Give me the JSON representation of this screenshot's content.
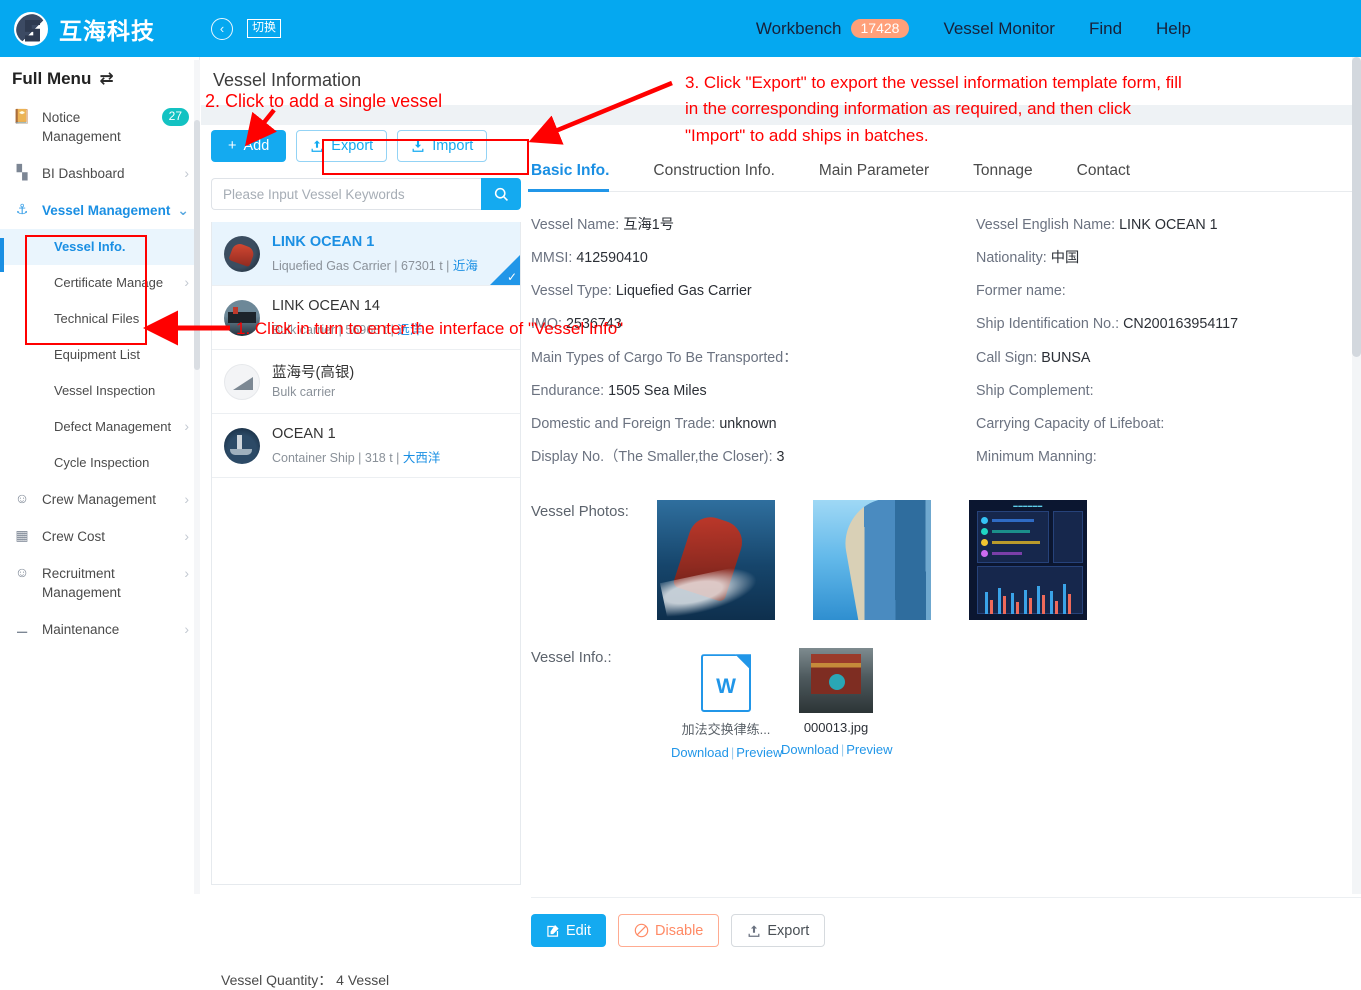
{
  "header": {
    "logo_text": "互海科技",
    "logo_icon": "company-logo-icon",
    "back_icon": "arrow-left-circle-icon",
    "switch_label": "切换",
    "workbench_label": "Workbench",
    "workbench_badge": "17428",
    "nav": [
      {
        "label": "Vessel Monitor"
      },
      {
        "label": "Find"
      },
      {
        "label": "Help"
      }
    ],
    "accent_color": "#05a8f0",
    "badge_color": "#ffa07a"
  },
  "sidebar": {
    "full_menu_label": "Full Menu",
    "swap_icon": "swap-horizontal-icon",
    "items": [
      {
        "label": "Notice Management",
        "icon": "book-icon",
        "count": "27"
      },
      {
        "label": "BI Dashboard",
        "icon": "bar-chart-icon",
        "chevron": "›"
      },
      {
        "label": "Vessel Management",
        "icon": "anchor-icon",
        "chevron": "⌄",
        "active_group": true
      }
    ],
    "vessel_children": [
      {
        "label": "Vessel Info.",
        "active": true
      },
      {
        "label": "Certificate Manage",
        "chevron": "›"
      },
      {
        "label": "Technical Files"
      },
      {
        "label": "Equipment List"
      },
      {
        "label": "Vessel Inspection"
      },
      {
        "label": "Defect Management",
        "chevron": "›"
      },
      {
        "label": "Cycle Inspection"
      }
    ],
    "items_after": [
      {
        "label": "Crew Management",
        "icon": "user-icon",
        "chevron": "›"
      },
      {
        "label": "Crew Cost",
        "icon": "wallet-icon",
        "chevron": "›"
      },
      {
        "label": "Recruitment Management",
        "icon": "user-plus-icon",
        "chevron": "›"
      },
      {
        "label": "Maintenance",
        "icon": "hammer-icon",
        "chevron": "›"
      }
    ]
  },
  "main": {
    "page_title": "Vessel Information",
    "list": {
      "add_label": "Add",
      "add_icon": "plus-icon",
      "export_label": "Export",
      "export_icon": "upload-icon",
      "import_label": "Import",
      "import_icon": "download-icon",
      "search_placeholder": "Please Input Vessel Keywords",
      "search_value": "",
      "search_icon": "search-icon",
      "quantity_label": "Vessel Quantity：",
      "quantity_value": "4 Vessel",
      "vessels": [
        {
          "name": "LINK OCEAN 1",
          "type": "Liquefied Gas Carrier",
          "tonnage": "67301 t",
          "zone": "近海",
          "meta": "Liquefied Gas Carrier | 67301 t | ",
          "selected": true
        },
        {
          "name": "LINK OCEAN 14",
          "type": "Bulk carrier",
          "tonnage": "56968 t",
          "zone": "远洋",
          "meta": "Bulk carrier | 56968 t | ",
          "selected": false
        },
        {
          "name": "蓝海号(高银)",
          "type": "Bulk carrier",
          "tonnage": "",
          "zone": "",
          "meta": "Bulk carrier",
          "selected": false
        },
        {
          "name": "OCEAN 1",
          "type": "Container Ship",
          "tonnage": "318 t",
          "zone": "大西洋",
          "meta": "Container Ship | 318 t | ",
          "selected": false
        }
      ]
    },
    "tabs": [
      {
        "label": "Basic Info.",
        "active": true
      },
      {
        "label": "Construction Info.",
        "active": false
      },
      {
        "label": "Main Parameter",
        "active": false
      },
      {
        "label": "Tonnage",
        "active": false
      },
      {
        "label": "Contact",
        "active": false
      }
    ],
    "fields_left": [
      {
        "label": "Vessel Name:",
        "value": "互海1号"
      },
      {
        "label": "MMSI:",
        "value": "412590410"
      },
      {
        "label": "Vessel Type:",
        "value": "Liquefied Gas Carrier"
      },
      {
        "label": "IMO:",
        "value": "2536743"
      },
      {
        "label": "Main Types of Cargo To Be Transported：",
        "value": ""
      },
      {
        "label": "Endurance:",
        "value": "1505 Sea Miles"
      },
      {
        "label": "Domestic and Foreign Trade:",
        "value": "unknown"
      },
      {
        "label": "Display No.（The Smaller,the Closer):",
        "value": "3"
      }
    ],
    "fields_right": [
      {
        "label": "Vessel English Name:",
        "value": "LINK OCEAN 1"
      },
      {
        "label": "Nationality:",
        "value": "中国"
      },
      {
        "label": "Former name:",
        "value": ""
      },
      {
        "label": "Ship Identification No.:",
        "value": "CN200163954117"
      },
      {
        "label": "Call Sign:",
        "value": "BUNSA"
      },
      {
        "label": "Ship Complement:",
        "value": ""
      },
      {
        "label": "Carrying Capacity of Lifeboat:",
        "value": ""
      },
      {
        "label": "Minimum Manning:",
        "value": ""
      }
    ],
    "photos_label": "Vessel Photos:",
    "photos": [
      {
        "name": "vessel-aerial-photo"
      },
      {
        "name": "building-photo"
      },
      {
        "name": "dashboard-screenshot"
      }
    ],
    "info_label": "Vessel Info.:",
    "attachments": [
      {
        "name": "加法交换律练...",
        "kind": "word-document",
        "download_label": "Download",
        "separator": "|",
        "preview_label": "Preview"
      },
      {
        "name": "000013.jpg",
        "kind": "image",
        "download_label": "Download",
        "separator": "|",
        "preview_label": "Preview"
      }
    ],
    "actions": {
      "edit_label": "Edit",
      "edit_icon": "edit-pencil-icon",
      "disable_label": "Disable",
      "disable_icon": "ban-icon",
      "export_label": "Export",
      "export_icon": "upload-icon"
    }
  },
  "annotations": {
    "color": "#ff0000",
    "step1": "1. Click in turn to enter the interface of \"Vessel Info\"",
    "step2": "2. Click to add a single vessel",
    "step3": "3. Click \"Export\" to export the vessel information template form, fill\nin the corresponding information as required, and then click\n\"Import\" to add ships in batches."
  }
}
